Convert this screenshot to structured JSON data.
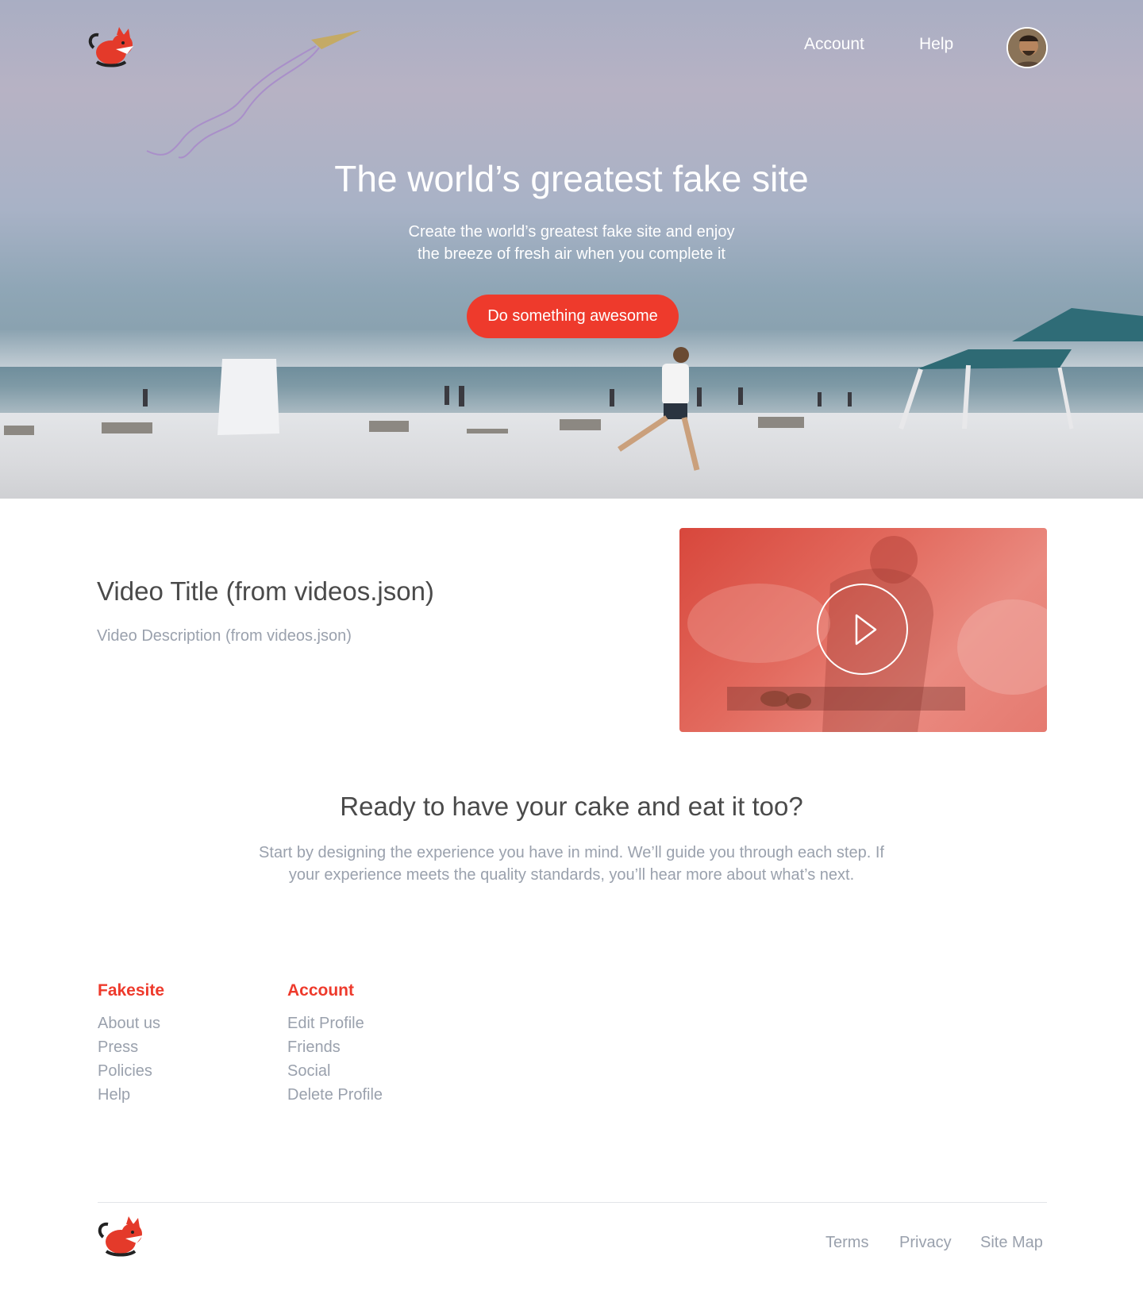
{
  "header": {
    "nav": [
      "Account",
      "Help"
    ]
  },
  "hero": {
    "title": "The world’s greatest fake site",
    "subtitle_line1": "Create the world’s greatest fake site and enjoy",
    "subtitle_line2": "the breeze of fresh air when you complete it",
    "cta_label": "Do something awesome"
  },
  "video": {
    "title": "Video Title (from videos.json)",
    "description": "Video Description (from videos.json)"
  },
  "promo": {
    "title": "Ready to have your cake and eat it too?",
    "text_line1": "Start by designing the experience you have in mind. We’ll guide you through each step. If",
    "text_line2": "your experience meets the quality standards, you’ll hear more about what’s next."
  },
  "footer": {
    "columns": [
      {
        "heading": "Fakesite",
        "links": [
          "About us",
          "Press",
          "Policies",
          "Help"
        ]
      },
      {
        "heading": "Account",
        "links": [
          "Edit Profile",
          "Friends",
          "Social",
          "Delete Profile"
        ]
      }
    ],
    "bottom_links": [
      "Terms",
      "Privacy",
      "Site Map"
    ]
  },
  "colors": {
    "accent": "#ee3a2c",
    "muted_text": "#9aa1ad",
    "body_text": "#4a4a4a"
  },
  "icons": {
    "logo": "fox-logo-icon",
    "play": "play-icon"
  }
}
